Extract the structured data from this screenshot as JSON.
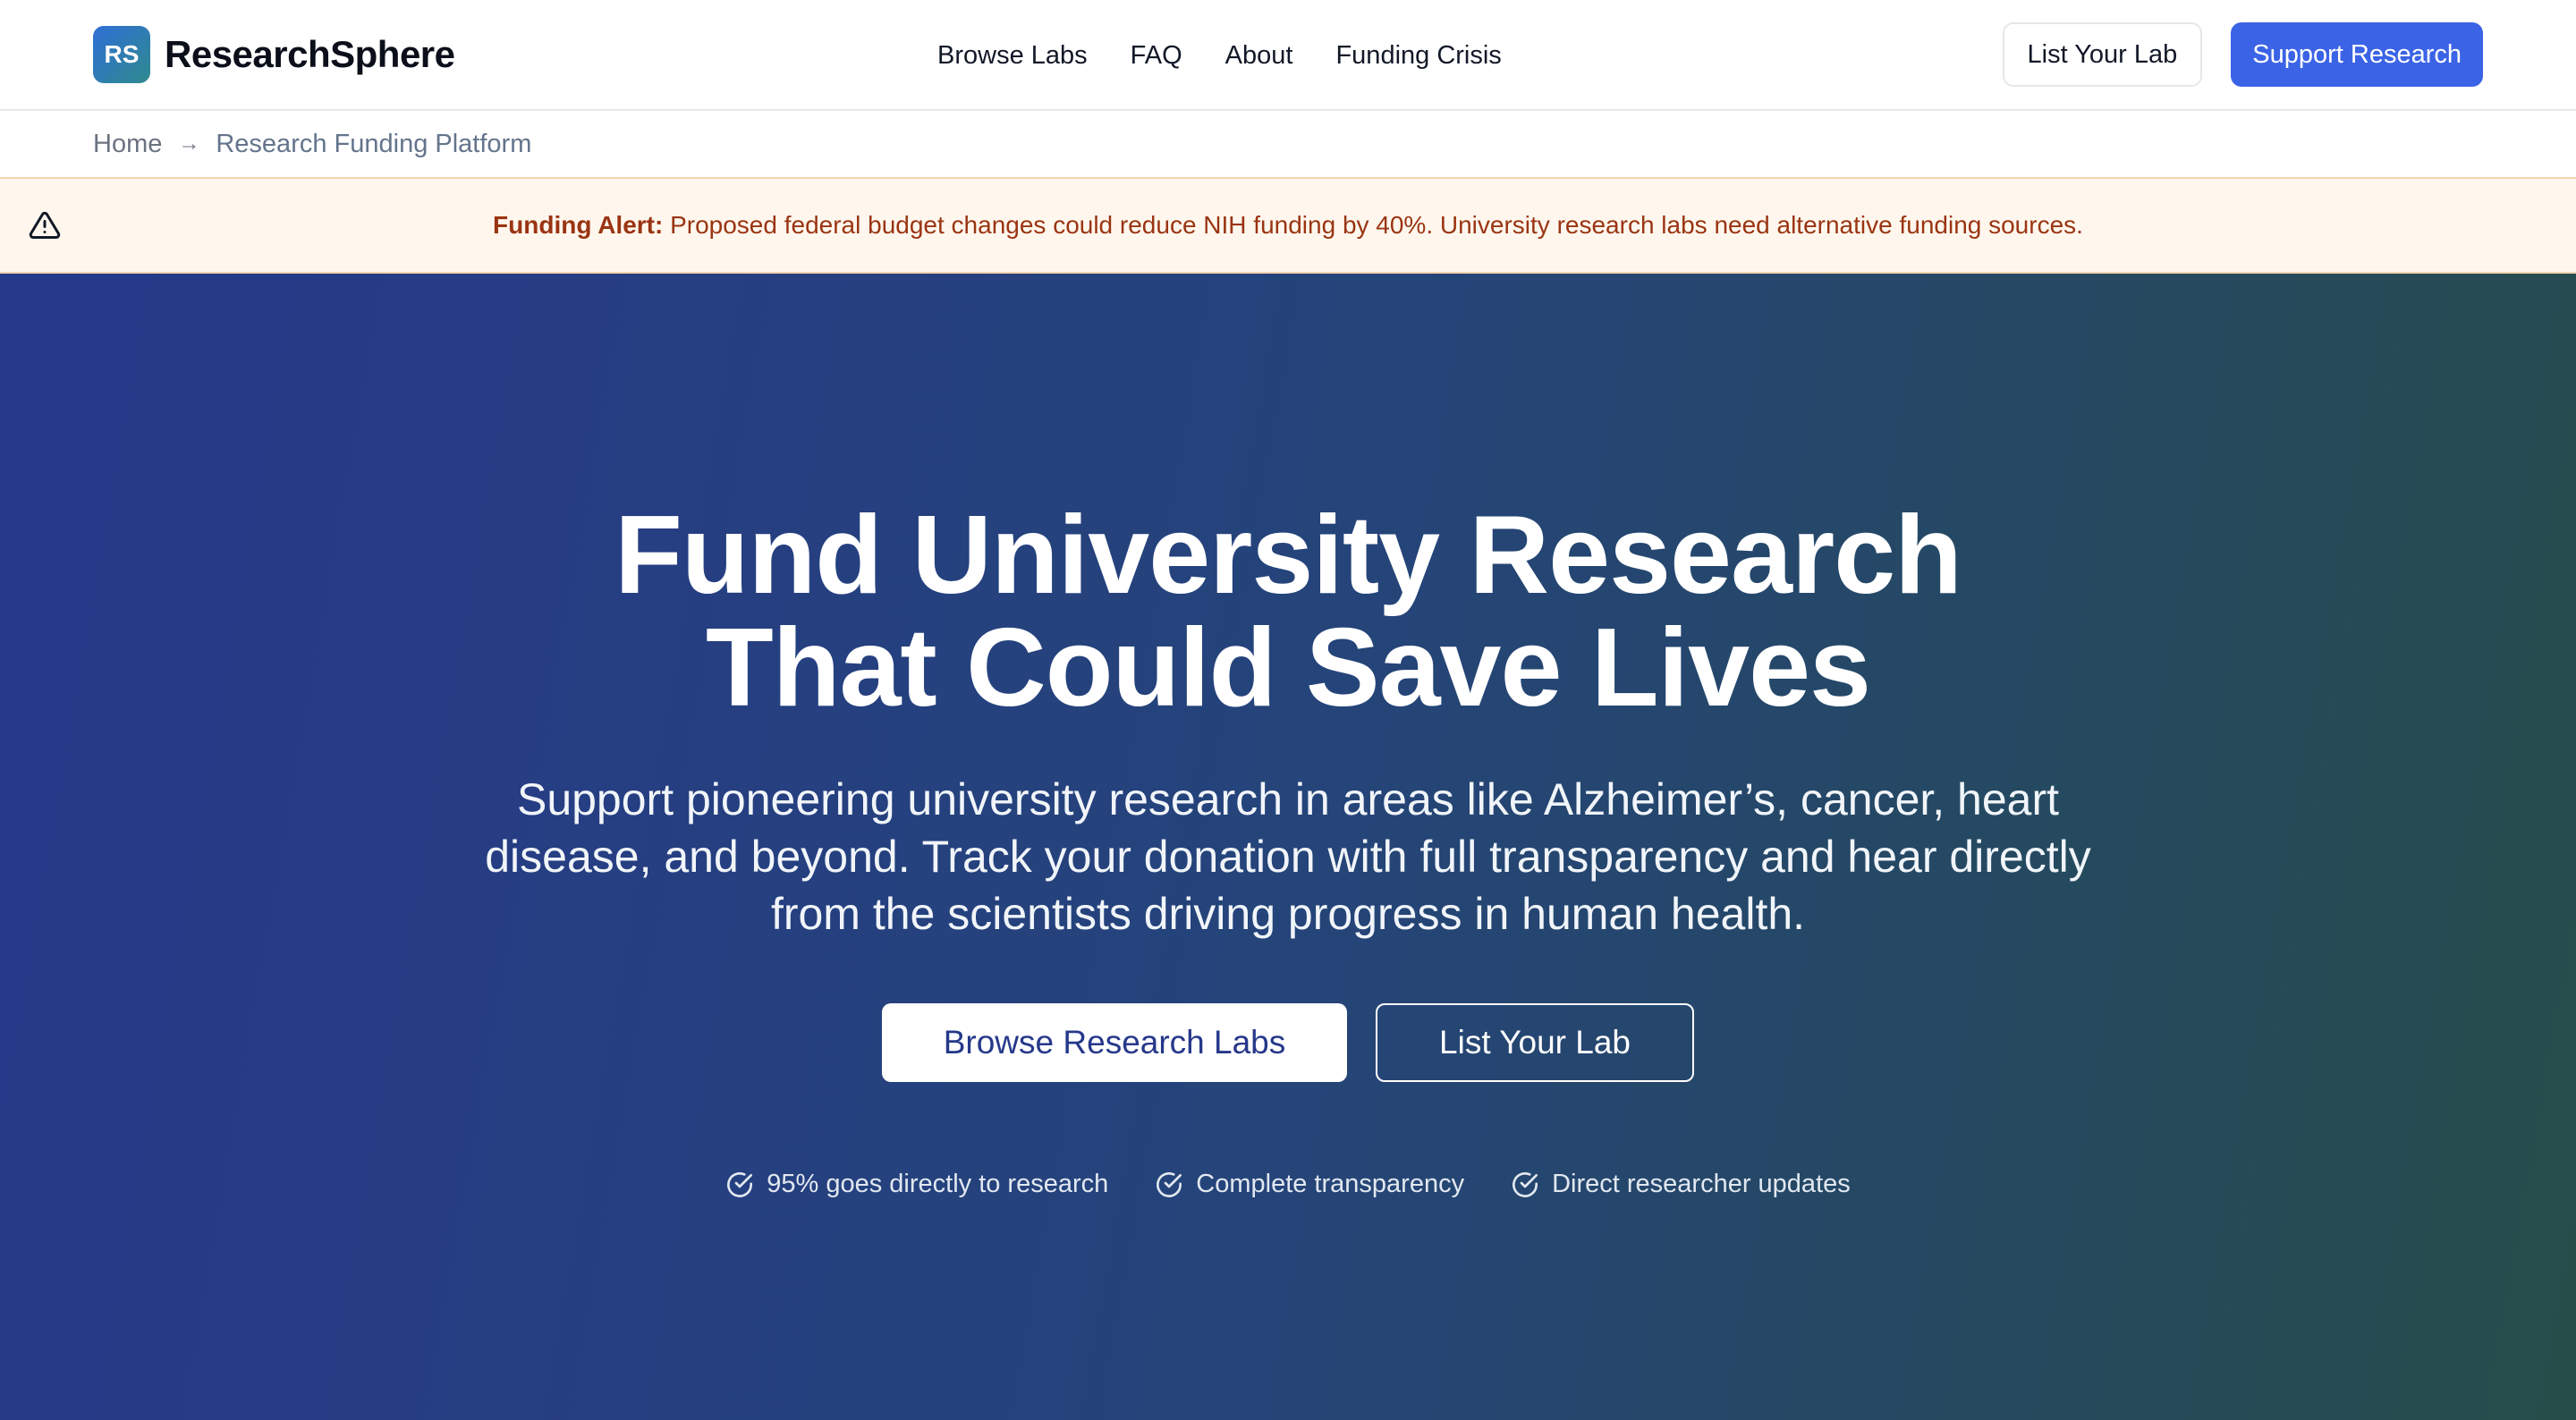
{
  "header": {
    "logo_text": "RS",
    "brand": "ResearchSphere",
    "nav": [
      "Browse Labs",
      "FAQ",
      "About",
      "Funding Crisis"
    ],
    "list_lab_label": "List Your Lab",
    "support_label": "Support Research"
  },
  "breadcrumb": {
    "home": "Home",
    "separator": "→",
    "current": "Research Funding Platform"
  },
  "alert": {
    "icon": "warning-triangle-icon",
    "label": "Funding Alert:",
    "message": "Proposed federal budget changes could reduce NIH funding by 40%. University research labs need alternative funding sources."
  },
  "hero": {
    "title_line1": "Fund University Research",
    "title_line2": "That Could Save Lives",
    "subtitle": "Support pioneering university research in areas like Alzheimer’s, cancer, heart disease, and beyond. Track your donation with full transparency and hear directly from the scientists driving progress in human health.",
    "primary_cta": "Browse Research Labs",
    "secondary_cta": "List Your Lab",
    "features": [
      "95% goes directly to research",
      "Complete transparency",
      "Direct researcher updates"
    ]
  },
  "colors": {
    "primary": "#3b63e6",
    "hero_start": "#26388a",
    "hero_end": "#254e4a",
    "alert_bg": "#fff7ed",
    "alert_text": "#9a3412"
  }
}
